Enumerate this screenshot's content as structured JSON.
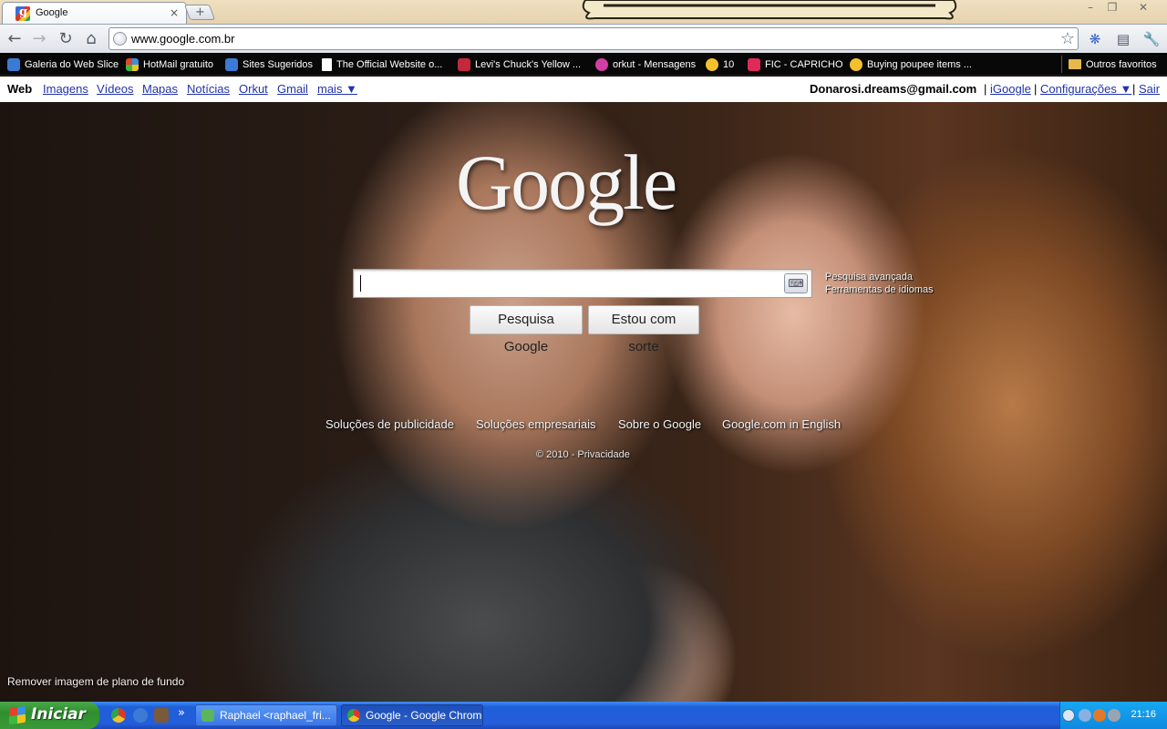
{
  "browser": {
    "tab_title": "Google",
    "tab_close": "×",
    "new_tab": "+",
    "url": "www.google.com.br",
    "window_controls": [
      "–",
      "❐",
      "✕"
    ]
  },
  "bookmarks": {
    "items": [
      {
        "label": "Galeria do Web Slice",
        "icon": "ie-icon",
        "color": "#3b7bd6"
      },
      {
        "label": "HotMail gratuito",
        "icon": "windows-flag-icon",
        "color": "#e0442a"
      },
      {
        "label": "Sites Sugeridos",
        "icon": "ie-icon",
        "color": "#3b7bd6"
      },
      {
        "label": "The Official Website o...",
        "icon": "page-icon",
        "color": "#ffffff"
      },
      {
        "label": "Levi's Chuck's Yellow ...",
        "icon": "levis-icon",
        "color": "#c3283c"
      },
      {
        "label": "orkut - Mensagens",
        "icon": "orkut-icon",
        "color": "#d23fa2"
      },
      {
        "label": "10",
        "icon": "duck-icon",
        "color": "#f2c12c"
      },
      {
        "label": "FIC - CAPRICHO",
        "icon": "capricho-icon",
        "color": "#e02a5a"
      },
      {
        "label": "Buying poupee items ...",
        "icon": "duck-icon",
        "color": "#f2c12c"
      }
    ],
    "other": "Outros favoritos"
  },
  "google_nav": {
    "links": [
      "Web",
      "Imagens",
      "Vídeos",
      "Mapas",
      "Notícias",
      "Orkut",
      "Gmail",
      "mais ▼"
    ],
    "account": "Donarosi.dreams@gmail.com",
    "separator": "|",
    "right_links": [
      "iGoogle",
      "Configurações ▼",
      "Sair"
    ]
  },
  "logo": "Google",
  "search": {
    "value": "",
    "advanced": "Pesquisa avançada",
    "language_tools": "Ferramentas de idiomas",
    "search_button": "Pesquisa Google",
    "lucky_button": "Estou com sorte"
  },
  "footer": {
    "links": [
      "Soluções de publicidade",
      "Soluções empresariais",
      "Sobre o Google",
      "Google.com in English"
    ],
    "copyright": "© 2010 - Privacidade"
  },
  "remove_background": "Remover imagem de plano de fundo",
  "taskbar": {
    "start": "Iniciar",
    "more": "»",
    "tasks": [
      {
        "label": "Raphael <raphael_fri...",
        "active": false,
        "color": "#5bb55b"
      },
      {
        "label": "Google - Google Chrome",
        "active": true,
        "color": "#f2c12c"
      }
    ],
    "clock": "21:16",
    "colors": {
      "bar": "#245edb",
      "start": "#3a9a3a",
      "tray": "#0e8ae0"
    }
  }
}
